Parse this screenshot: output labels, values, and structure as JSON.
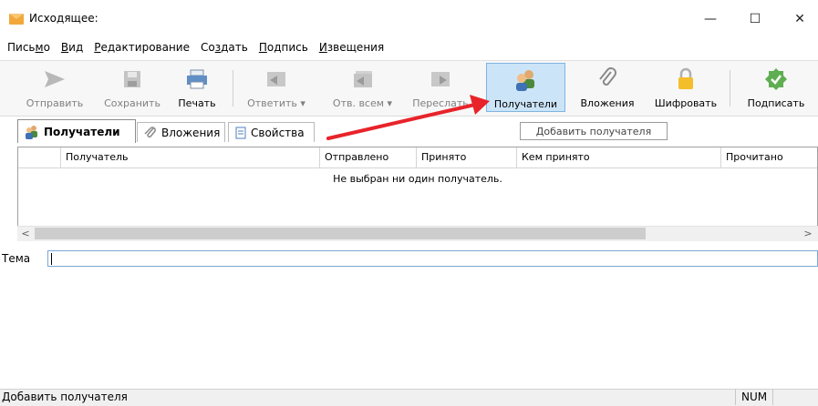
{
  "window": {
    "title": "Исходящее:",
    "controls": [
      "—",
      "☐",
      "✕"
    ]
  },
  "menu": [
    {
      "label": "Письмо",
      "mnemonic_pre": "Пись",
      "mnemonic": "м",
      "mnemonic_post": "о"
    },
    {
      "label": "Вид",
      "mnemonic_pre": "",
      "mnemonic": "В",
      "mnemonic_post": "ид"
    },
    {
      "label": "Редактирование",
      "mnemonic_pre": "",
      "mnemonic": "Р",
      "mnemonic_post": "едактирование"
    },
    {
      "label": "Создать",
      "mnemonic_pre": "Со",
      "mnemonic": "з",
      "mnemonic_post": "дать"
    },
    {
      "label": "Подпись",
      "mnemonic_pre": "",
      "mnemonic": "П",
      "mnemonic_post": "одпись"
    },
    {
      "label": "Извещения",
      "mnemonic_pre": "",
      "mnemonic": "И",
      "mnemonic_post": "звещения"
    }
  ],
  "toolbar": {
    "send": "Отправить",
    "save": "Сохранить",
    "print": "Печать",
    "reply": "Ответить",
    "reply_all": "Отв. всем",
    "forward": "Переслать",
    "recipients": "Получатели",
    "attachments": "Вложения",
    "encrypt": "Шифровать",
    "sign": "Подписать",
    "dropdown_glyph": "▾"
  },
  "tabs": [
    {
      "label": "Получатели",
      "active": true
    },
    {
      "label": "Вложения",
      "active": false
    },
    {
      "label": "Свойства",
      "active": false
    }
  ],
  "add_recipient_button": "Добавить получателя",
  "table": {
    "columns": [
      "Получатель",
      "Отправлено",
      "Принято",
      "Кем принято",
      "Прочитано"
    ],
    "empty_message": "Не выбран ни один получатель."
  },
  "scrollbar": {
    "left_arrow": "<",
    "right_arrow": ">"
  },
  "subject": {
    "label": "Тема",
    "value": ""
  },
  "statusbar": {
    "text": "Добавить получателя",
    "num": "NUM"
  },
  "colors": {
    "accent": "#cce4f7",
    "annotation": "#e8232a",
    "envelope": "#f2a83b"
  }
}
